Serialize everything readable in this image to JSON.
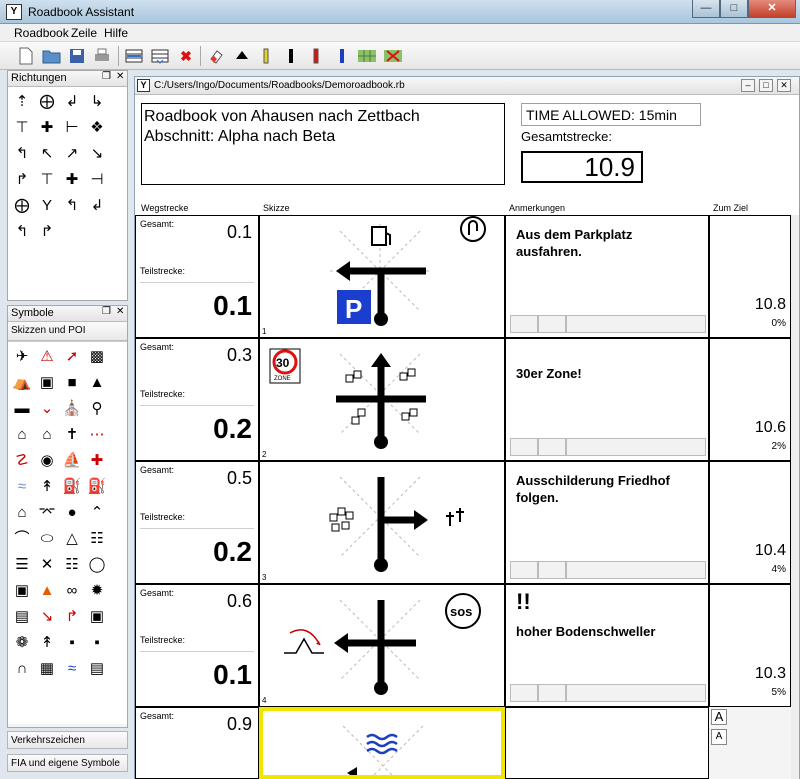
{
  "app": {
    "title": "Roadbook Assistant",
    "icon_letter": "Y"
  },
  "menu": [
    "Roadbook",
    "Zeile",
    "Hilfe"
  ],
  "panels": {
    "richtungen": {
      "label": "Richtungen"
    },
    "symbole": {
      "label": "Symbole",
      "tab": "Skizzen und POI"
    },
    "tabs": [
      "Verkehrszeichen",
      "FIA und eigene Symbole"
    ]
  },
  "document": {
    "path": "C:/Users/Ingo/Documents/Roadbooks/Demoroadbook.rb",
    "title_line1": "Roadbook von Ahausen nach Zettbach",
    "title_line2": "Abschnitt: Alpha nach Beta",
    "time_allowed": "TIME ALLOWED: 15min",
    "gesamtstrecke_label": "Gesamtstrecke:",
    "total": "10.9"
  },
  "columns": [
    "Wegstrecke",
    "Skizze",
    "Anmerkungen",
    "Zum Ziel"
  ],
  "labels": {
    "gesamt": "Gesamt:",
    "teilstrecke": "Teilstrecke:"
  },
  "rows": [
    {
      "num": "1",
      "total": "0.1",
      "part": "0.1",
      "note": "Aus dem Parkplatz\nausfahren.",
      "goal": "10.8",
      "pct": "0%"
    },
    {
      "num": "2",
      "total": "0.3",
      "part": "0.2",
      "note": "30er Zone!",
      "goal": "10.6",
      "pct": "2%",
      "zone_sign": "30",
      "zone_word": "ZONE"
    },
    {
      "num": "3",
      "total": "0.5",
      "part": "0.2",
      "note": "Ausschilderung Friedhof\nfolgen.",
      "goal": "10.4",
      "pct": "4%"
    },
    {
      "num": "4",
      "total": "0.6",
      "part": "0.1",
      "note_mark": "!!",
      "note": "hoher Bodenschweller",
      "goal": "10.3",
      "pct": "5%",
      "sos": "sos"
    },
    {
      "total": "0.9"
    }
  ],
  "font_buttons": [
    "A",
    "A"
  ]
}
